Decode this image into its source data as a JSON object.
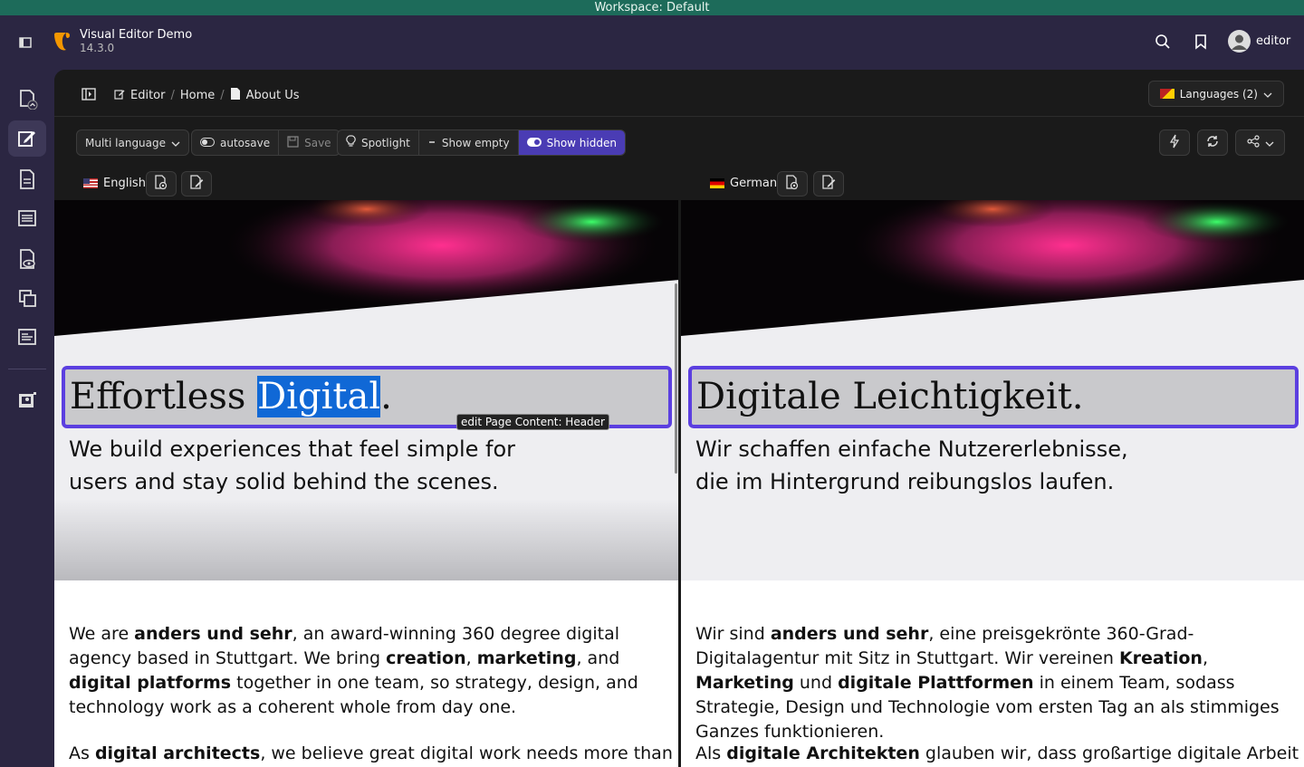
{
  "workspace": "Workspace: Default",
  "site": {
    "name": "Visual Editor Demo",
    "version": "14.3.0"
  },
  "user": {
    "name": "editor"
  },
  "breadcrumb": {
    "editor": "Editor",
    "home": "Home",
    "page": "About Us"
  },
  "languages_button": "Languages (2)",
  "toolbar": {
    "language_mode": "Multi language",
    "autosave": "autosave",
    "save": "Save",
    "spotlight": "Spotlight",
    "show_empty": "Show empty",
    "show_hidden": "Show hidden"
  },
  "panes": {
    "english": {
      "label": "English",
      "header_pre": "Effortless ",
      "header_sel": "Digital",
      "header_post": ".",
      "sub_line1": "We build experiences that feel simple for",
      "sub_line2": "users and stay solid behind the scenes.",
      "b1": "We are ",
      "b2": "anders und sehr",
      "b3": ", an award-winning 360 degree digital agency based in Stuttgart. We bring ",
      "b4": "creation",
      "b5": ", ",
      "b6": "marketing",
      "b7": ", and ",
      "b8": "digital platforms",
      "b9": " together in one team, so strategy, design, and technology work as a coherent whole from day one.",
      "p2a": "As ",
      "p2b": "digital architects",
      "p2c": ", we believe great digital work needs more than a"
    },
    "german": {
      "label": "German",
      "header": "Digitale Leichtigkeit.",
      "sub_line1": "Wir schaffen einfache Nutzererlebnisse,",
      "sub_line2": "die im Hintergrund reibungslos laufen.",
      "b1": "Wir sind ",
      "b2": "anders und sehr",
      "b3": ", eine preisgekrönte 360-Grad-Digitalagentur mit Sitz in Stuttgart. Wir vereinen ",
      "b4": "Kreation",
      "b5": ", ",
      "b6": "Marketing",
      "b7": " und ",
      "b8": "digitale Plattformen",
      "b9": " in einem Team, sodass Strategie, Design und Technologie vom ersten Tag an als stimmiges Ganzes funktionieren.",
      "p2a": "Als ",
      "p2b": "digitale Architekten",
      "p2c": " glauben wir, dass großartige digitale Arbeit mehr als"
    }
  },
  "tooltip": "edit Page Content: Header",
  "colors": {
    "accent": "#5b3fe0",
    "toggle_on": "#4a3cb4",
    "workspace_bar": "#1d6b5a",
    "selection": "#1068d6"
  }
}
